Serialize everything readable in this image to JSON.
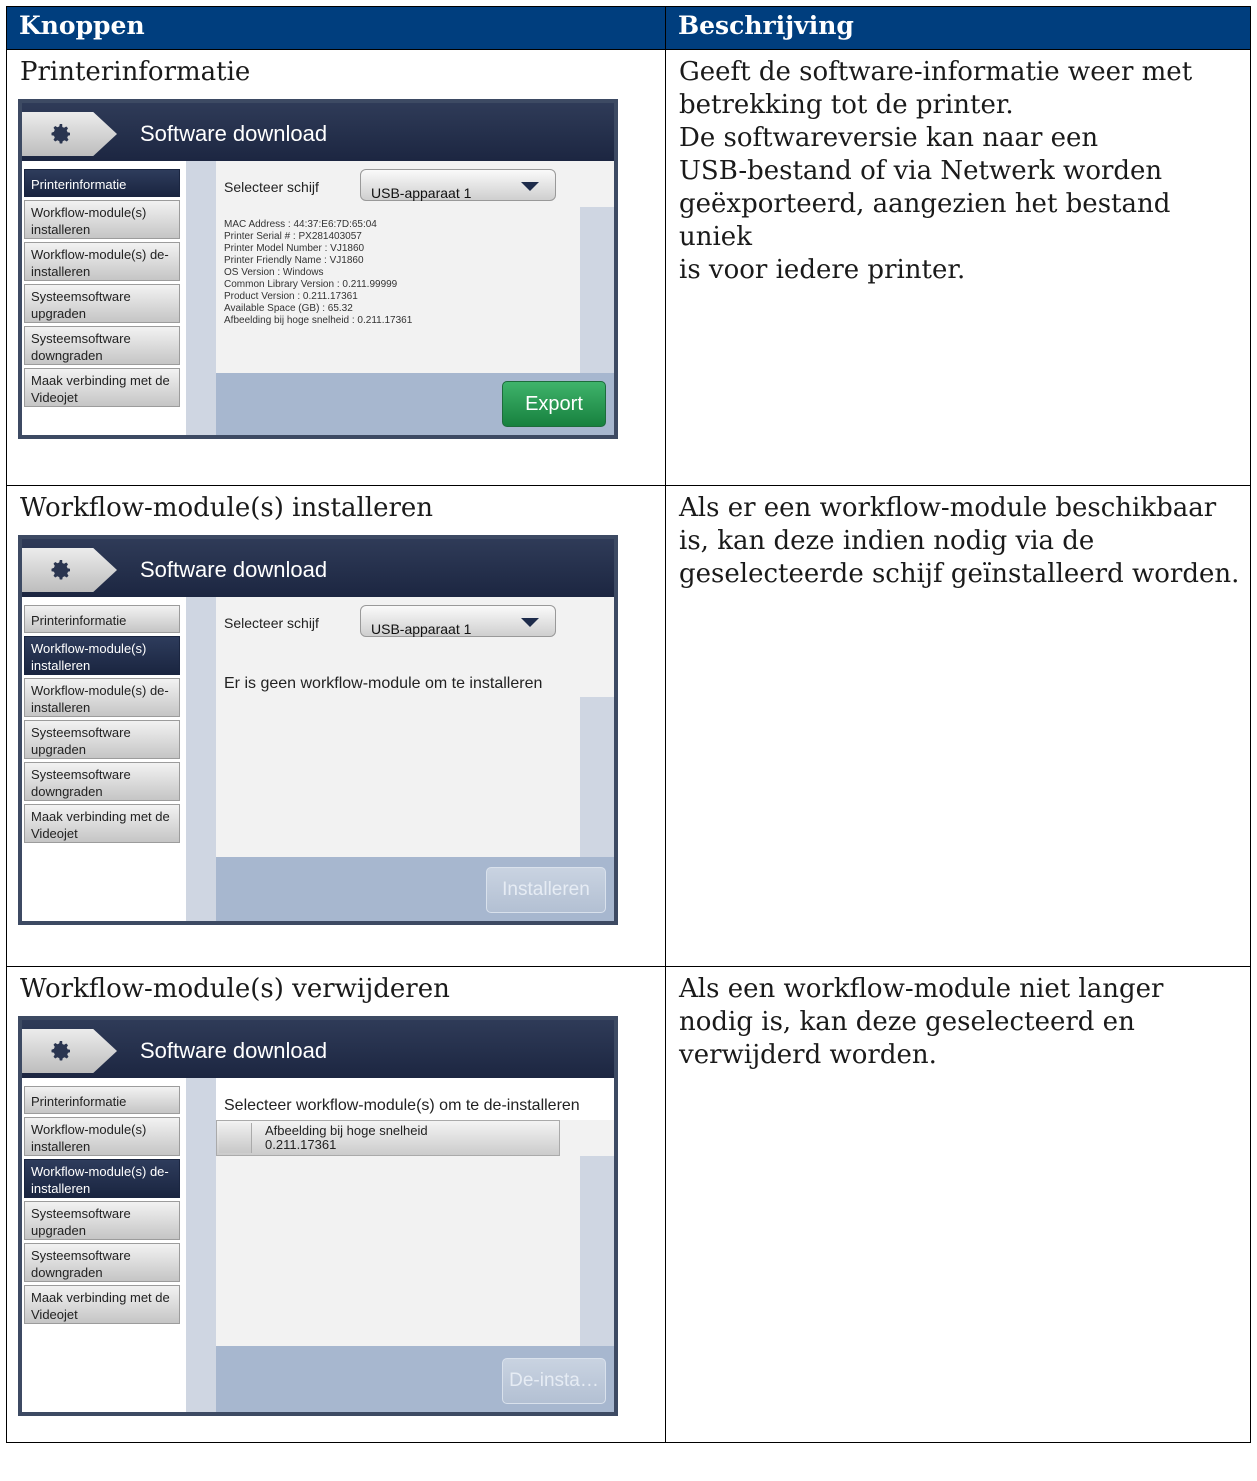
{
  "table": {
    "header_buttons": "Knoppen",
    "header_description": "Beschrijving"
  },
  "rows": [
    {
      "title": "Printerinformatie",
      "description": [
        "Geeft de software-informatie weer met",
        "betrekking tot de printer.",
        "De softwareversie kan naar een",
        "USB-bestand of via Netwerk worden",
        "geëxporteerd, aangezien het bestand uniek",
        "is voor iedere printer."
      ]
    },
    {
      "title": "Workflow-module(s) installeren",
      "description": [
        "Als er een workflow-module beschikbaar",
        "is, kan deze indien nodig via de",
        "geselecteerde schijf geïnstalleerd worden."
      ]
    },
    {
      "title": "Workflow-module(s) verwijderen",
      "description": [
        "Als een workflow-module niet langer",
        "nodig is, kan deze geselecteerd en",
        "verwijderd worden."
      ]
    }
  ],
  "screen": {
    "title": "Software download",
    "sidebar": [
      "Printerinformatie",
      "Workflow-module(s) installeren",
      "Workflow-module(s) de-installeren",
      "Systeemsoftware upgraden",
      "Systeemsoftware downgraden",
      "Maak verbinding met de Videojet"
    ],
    "select_label": "Selecteer schijf",
    "select_value": "USB-apparaat 1",
    "info_lines": [
      "MAC Address : 44:37:E6:7D:65:04",
      "Printer Serial # : PX281403057",
      "Printer Model Number : VJ1860",
      "Printer Friendly Name : VJ1860",
      "OS Version : Windows",
      "Common Library Version : 0.211.99999",
      "Product Version : 0.211.17361",
      "Available Space (GB) : 65.32",
      "Afbeelding bij hoge snelheid : 0.211.17361"
    ],
    "export_label": "Export",
    "no_module_msg": "Er is geen workflow-module om te installeren",
    "install_label": "Installeren",
    "uninstall_header": "Selecteer workflow-module(s) om te de-installeren",
    "module_name": "Afbeelding bij hoge snelheid",
    "module_version": "0.211.17361",
    "uninstall_label": "De-insta…"
  }
}
